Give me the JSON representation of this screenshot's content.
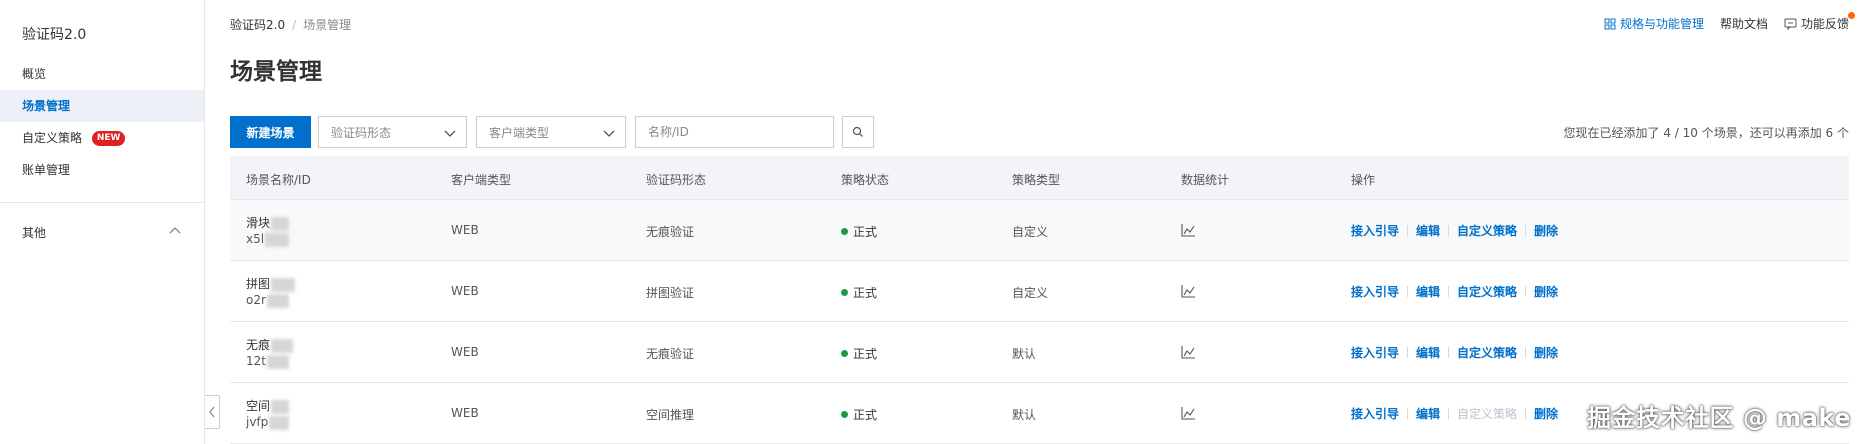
{
  "sidebar": {
    "title": "验证码2.0",
    "items": [
      {
        "label": "概览"
      },
      {
        "label": "场景管理"
      },
      {
        "label": "自定义策略",
        "badge": "NEW"
      },
      {
        "label": "账单管理"
      }
    ],
    "other_label": "其他"
  },
  "breadcrumb": {
    "root": "验证码2.0",
    "separator": "/",
    "current": "场景管理"
  },
  "top_links": {
    "specs": "规格与功能管理",
    "help": "帮助文档",
    "feedback": "功能反馈"
  },
  "page_title": "场景管理",
  "toolbar": {
    "new_button": "新建场景",
    "captcha_type_placeholder": "验证码形态",
    "client_type_placeholder": "客户端类型",
    "search_placeholder": "名称/ID",
    "quota_text": "您现在已经添加了 4 / 10 个场景，还可以再添加 6 个"
  },
  "table": {
    "headers": [
      "场景名称/ID",
      "客户端类型",
      "验证码形态",
      "策略状态",
      "策略类型",
      "数据统计",
      "操作"
    ],
    "rows": [
      {
        "name": "滑块",
        "id": "x5l",
        "client": "WEB",
        "form": "无痕验证",
        "status": "正式",
        "policy": "自定义",
        "custom_policy_enabled": true
      },
      {
        "name": "拼图",
        "id": "o2r",
        "client": "WEB",
        "form": "拼图验证",
        "status": "正式",
        "policy": "自定义",
        "custom_policy_enabled": true
      },
      {
        "name": "无痕",
        "id": "12t",
        "client": "WEB",
        "form": "无痕验证",
        "status": "正式",
        "policy": "默认",
        "custom_policy_enabled": true
      },
      {
        "name": "空间",
        "id": "jvfp",
        "client": "WEB",
        "form": "空间推理",
        "status": "正式",
        "policy": "默认",
        "custom_policy_enabled": false
      }
    ],
    "ops": {
      "guide": "接入引导",
      "edit": "编辑",
      "custom": "自定义策略",
      "delete": "删除"
    }
  },
  "watermark": "掘金技术社区 @ make",
  "colors": {
    "primary": "#0070cc",
    "status_green": "#1a9c3f",
    "badge_red": "#e02020",
    "active_bg": "#edf1f7"
  }
}
